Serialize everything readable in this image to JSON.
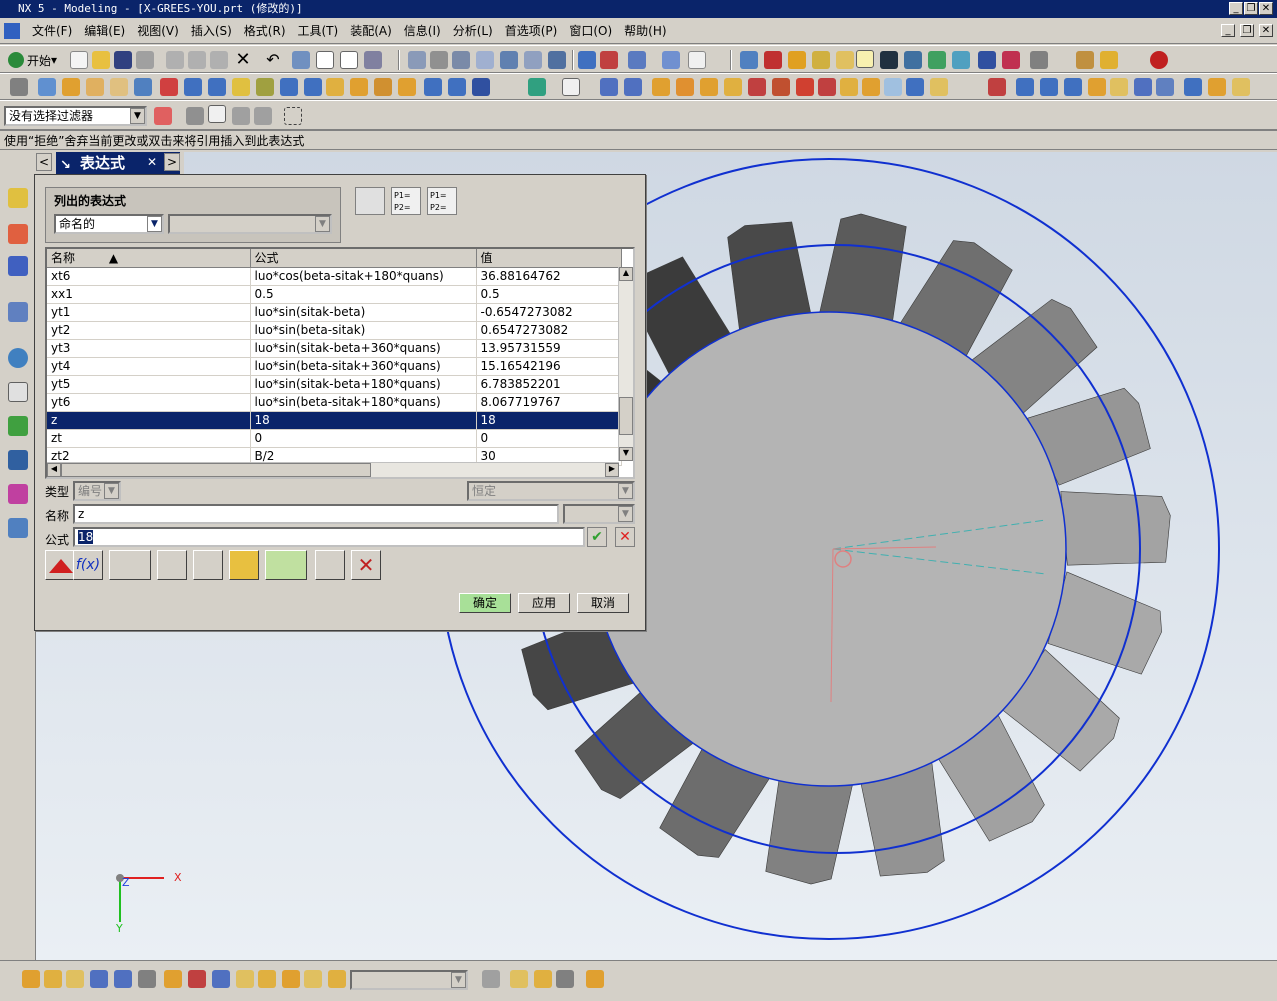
{
  "window": {
    "title": "NX 5 - Modeling - [X-GREES-YOU.prt (修改的)]"
  },
  "menu": [
    "文件(F)",
    "编辑(E)",
    "视图(V)",
    "插入(S)",
    "格式(R)",
    "工具(T)",
    "装配(A)",
    "信息(I)",
    "分析(L)",
    "首选项(P)",
    "窗口(O)",
    "帮助(H)"
  ],
  "toolbar": {
    "start_label": "开始"
  },
  "filter": {
    "value": "没有选择过滤器"
  },
  "hint": "使用“拒绝”舍弃当前更改或双击来将引用插入到此表达式",
  "dialog": {
    "title": "表达式",
    "listed_label": "列出的表达式",
    "listed_select": "命名的",
    "columns": [
      "名称",
      "公式",
      "值"
    ],
    "rows": [
      {
        "name": "xt6",
        "formula": "luo*cos(beta-sitak+180*quans)",
        "value": "36.88164762"
      },
      {
        "name": "xx1",
        "formula": "0.5",
        "value": "0.5"
      },
      {
        "name": "yt1",
        "formula": "luo*sin(sitak-beta)",
        "value": "-0.6547273082"
      },
      {
        "name": "yt2",
        "formula": "luo*sin(beta-sitak)",
        "value": "0.6547273082"
      },
      {
        "name": "yt3",
        "formula": "luo*sin(sitak-beta+360*quans)",
        "value": "13.95731559"
      },
      {
        "name": "yt4",
        "formula": "luo*sin(beta-sitak+360*quans)",
        "value": "15.16542196"
      },
      {
        "name": "yt5",
        "formula": "luo*sin(sitak-beta+180*quans)",
        "value": "6.783852201"
      },
      {
        "name": "yt6",
        "formula": "luo*sin(beta-sitak+180*quans)",
        "value": "8.067719767"
      },
      {
        "name": "z",
        "formula": "18",
        "value": "18"
      },
      {
        "name": "zt",
        "formula": "0",
        "value": "0"
      },
      {
        "name": "zt2",
        "formula": "B/2",
        "value": "30"
      }
    ],
    "type_label": "类型",
    "type_value": "编号",
    "unit_value": "恒定",
    "name_label": "名称",
    "name_value": "z",
    "formula_label": "公式",
    "formula_value": "18",
    "ok": "确定",
    "apply": "应用",
    "cancel": "取消"
  },
  "axes": {
    "x": "X",
    "y": "Y",
    "z": "Z"
  },
  "colors": {
    "titlebar": "#0a246a",
    "selection": "#0a246a",
    "gear_outline": "#1030d0",
    "viewport_bg": "#dde4ec"
  }
}
